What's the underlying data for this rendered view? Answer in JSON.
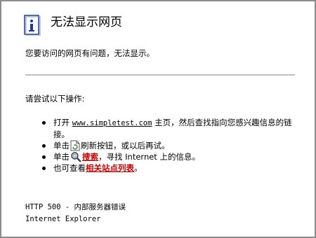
{
  "page": {
    "title": "无法显示网页",
    "subtitle": "您要访问的网页有问题，无法显示。",
    "prompt": "请尝试以下操作:"
  },
  "items": {
    "item1_prefix": "打开 ",
    "item1_site": "www.simpletest.com",
    "item1_suffix": " 主页，然后查找指向您感兴趣信息的链接。",
    "item2_prefix": "单击",
    "item2_suffix": "刷新按钮，或以后再试。",
    "item3_prefix": "单击",
    "item3_link": "搜索",
    "item3_suffix": "，寻找 Internet 上的信息。",
    "item4_prefix": "也可查看",
    "item4_link": "相关站点列表",
    "item4_suffix": "。"
  },
  "footer": {
    "error": "HTTP 500 - 内部服务器错误",
    "browser": "Internet Explorer"
  },
  "icons": {
    "info": "info-icon",
    "refresh": "refresh-icon",
    "search": "search-icon"
  },
  "colors": {
    "link_red": "#cc0000",
    "info_blue": "#1f3a93",
    "rule": "#c0c0c0"
  }
}
